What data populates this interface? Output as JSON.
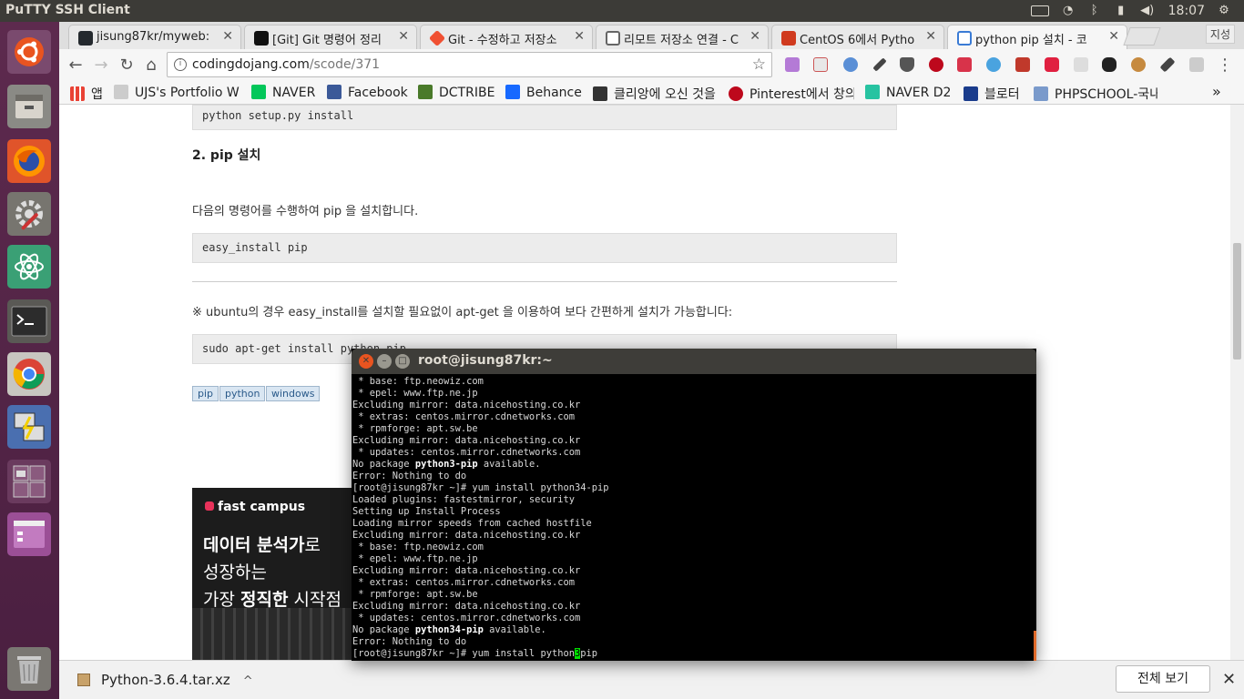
{
  "top_panel": {
    "app_title": "PuTTY SSH Client",
    "clock": "18:07"
  },
  "tabs": [
    {
      "label": "jisung87kr/myweb:",
      "fav_color": "#24292e"
    },
    {
      "label": "[Git] Git 명령어 정리",
      "fav_color": "#111111"
    },
    {
      "label": "Git - 수정하고 저장소",
      "fav_color": "#f05032"
    },
    {
      "label": "리모트 저장소 연결 - C",
      "fav_color": "#666666"
    },
    {
      "label": "CentOS 6에서 Pytho",
      "fav_color": "#d03a1e"
    },
    {
      "label": "python pip 설치 - 코",
      "fav_color": "#3a7bd5"
    }
  ],
  "profile_label": "지성",
  "omnibox": {
    "host": "codingdojang.com",
    "path": "/scode/371"
  },
  "bookmarks": [
    {
      "label": "앱",
      "color": "#e94235"
    },
    {
      "label": "UJS's Portfolio W",
      "color": "#888888"
    },
    {
      "label": "NAVER",
      "color": "#03c75a"
    },
    {
      "label": "Facebook",
      "color": "#3b5998"
    },
    {
      "label": "DCTRIBE",
      "color": "#4a7a2a"
    },
    {
      "label": "Behance",
      "color": "#1769ff"
    },
    {
      "label": "클리앙에 오신 것을",
      "color": "#333333"
    },
    {
      "label": "Pinterest에서 창의",
      "color": "#bd081c"
    },
    {
      "label": "NAVER D2",
      "color": "#27c3a1"
    },
    {
      "label": "블로터",
      "color": "#1a3c8c"
    },
    {
      "label": "PHPSCHOOL-국내",
      "color": "#7a9acb"
    }
  ],
  "page": {
    "code1": "python setup.py install",
    "heading": "2. pip 설치",
    "para1": "다음의 명령어를 수행하여 pip 을 설치합니다.",
    "code2": "easy_install pip",
    "note": "※ ubuntu의 경우 easy_install를 설치할 필요없이 apt-get 을 이용하여 보다 간편하게 설치가 가능합니다:",
    "code3": "sudo apt-get install python-pip",
    "tags": [
      "pip",
      "python",
      "windows"
    ],
    "ad": {
      "brand": "fast campus",
      "line1_bold": "데이터 분석가",
      "line1_rest": "로",
      "line2": "성장하는",
      "line3_pre": "가장 ",
      "line3_bold": "정직한",
      "line3_rest": " 시작점"
    }
  },
  "download": {
    "filename": "Python-3.6.4.tar.xz",
    "show_all": "전체 보기"
  },
  "terminal": {
    "title": "root@jisung87kr:~",
    "lines": [
      " * base: ftp.neowiz.com",
      " * epel: www.ftp.ne.jp",
      "Excluding mirror: data.nicehosting.co.kr",
      " * extras: centos.mirror.cdnetworks.com",
      " * rpmforge: apt.sw.be",
      "Excluding mirror: data.nicehosting.co.kr",
      " * updates: centos.mirror.cdnetworks.com",
      "No package python3-pip available.",
      "Error: Nothing to do",
      "[root@jisung87kr ~]# yum install python34-pip",
      "Loaded plugins: fastestmirror, security",
      "Setting up Install Process",
      "Loading mirror speeds from cached hostfile",
      "Excluding mirror: data.nicehosting.co.kr",
      " * base: ftp.neowiz.com",
      " * epel: www.ftp.ne.jp",
      "Excluding mirror: data.nicehosting.co.kr",
      " * extras: centos.mirror.cdnetworks.com",
      " * rpmforge: apt.sw.be",
      "Excluding mirror: data.nicehosting.co.kr",
      " * updates: centos.mirror.cdnetworks.com",
      "No package python34-pip available.",
      "Error: Nothing to do"
    ],
    "prompt_before": "[root@jisung87kr ~]# yum install python",
    "prompt_cursor": "3",
    "prompt_after": "pip"
  }
}
